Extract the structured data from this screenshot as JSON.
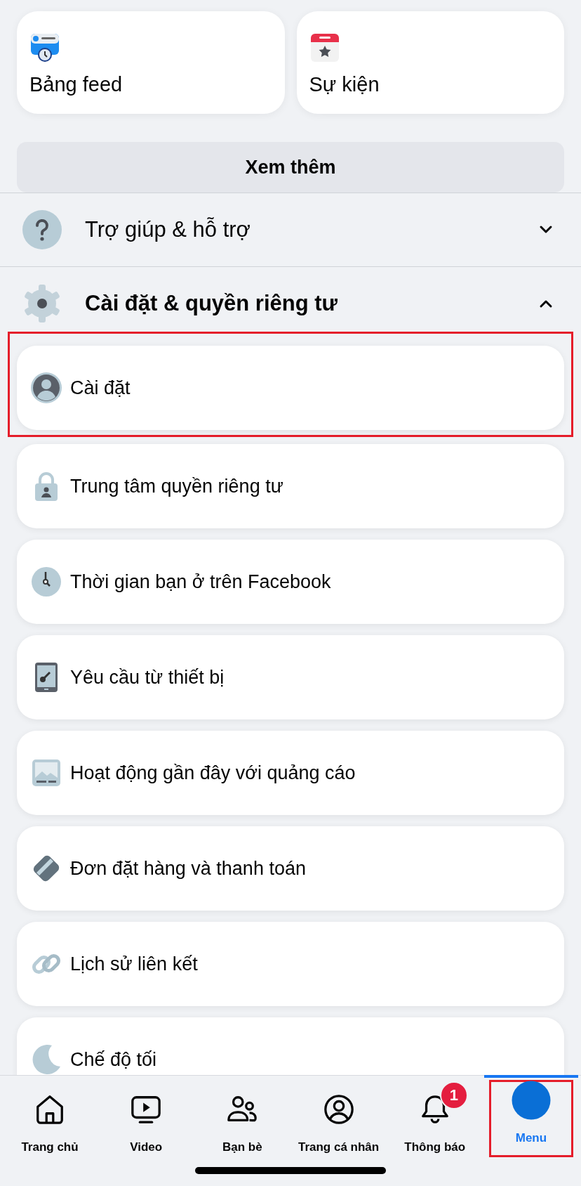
{
  "shortcuts": [
    {
      "label": "Bảng feed"
    },
    {
      "label": "Sự kiện"
    }
  ],
  "more_button": "Xem thêm",
  "sections": [
    {
      "title": "Trợ giúp & hỗ trợ",
      "expanded": false
    },
    {
      "title": "Cài đặt & quyền riêng tư",
      "expanded": true,
      "items": [
        {
          "label": "Cài đặt",
          "highlighted": true
        },
        {
          "label": "Trung tâm quyền riêng tư",
          "highlighted": false
        },
        {
          "label": "Thời gian bạn ở trên Facebook",
          "highlighted": false
        },
        {
          "label": "Yêu cầu từ thiết bị",
          "highlighted": false
        },
        {
          "label": "Hoạt động gần đây với quảng cáo",
          "highlighted": false
        },
        {
          "label": "Đơn đặt hàng và thanh toán",
          "highlighted": false
        },
        {
          "label": "Lịch sử liên kết",
          "highlighted": false
        },
        {
          "label": "Chế độ tối",
          "highlighted": false
        }
      ]
    }
  ],
  "nav": [
    {
      "label": "Trang chủ",
      "selected": false,
      "highlighted": false
    },
    {
      "label": "Video",
      "selected": false,
      "highlighted": false
    },
    {
      "label": "Bạn bè",
      "selected": false,
      "highlighted": false
    },
    {
      "label": "Trang cá nhân",
      "selected": false,
      "highlighted": false
    },
    {
      "label": "Thông báo",
      "badge": "1",
      "selected": false,
      "highlighted": false
    },
    {
      "label": "Menu",
      "selected": true,
      "highlighted": true
    }
  ]
}
